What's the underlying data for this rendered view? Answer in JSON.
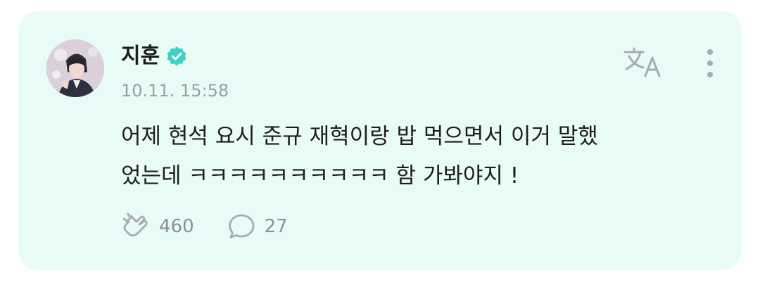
{
  "post": {
    "author_name": "지훈",
    "verified": true,
    "timestamp": "10.11. 15:58",
    "text": "어제 현석 요시 준규 재혁이랑 밥 먹으면서 이거 말했었는데 ㅋㅋㅋㅋㅋㅋㅋㅋㅋㅋ 함 가봐야지 !",
    "text_line_1": "어제 현석 요시 준규 재혁이랑 밥 먹으면서 이거 말했",
    "text_line_2": "었는데 ㅋㅋㅋㅋㅋㅋㅋㅋㅋㅋ 함 가봐야지 !"
  },
  "actions": {
    "reactions_count": "460",
    "comments_count": "27"
  },
  "icons": {
    "verified": "verified-badge-icon",
    "translate": "translate-icon",
    "more": "more-vertical-icon",
    "reaction": "reaction-hands-icon",
    "comment": "comment-bubble-icon"
  },
  "colors": {
    "card_background": "#e9fbf6",
    "verified_badge": "#3bd1c5",
    "icon_gray": "#a6abae",
    "text_primary": "#1d1d1d",
    "text_secondary": "#9a9fa2"
  }
}
